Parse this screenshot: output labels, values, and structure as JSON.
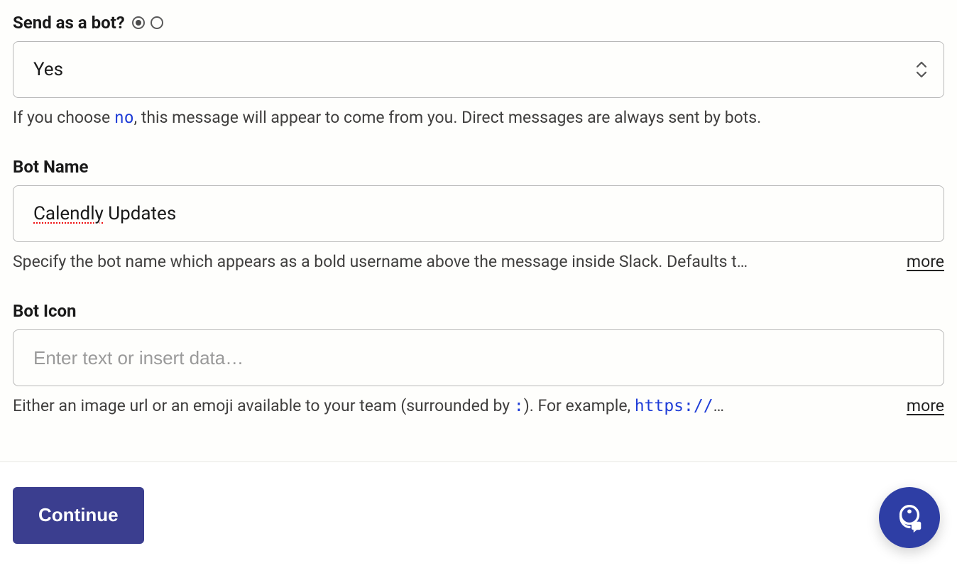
{
  "sendAsBot": {
    "label": "Send as a bot?",
    "radio_selected_index": 0,
    "select_value": "Yes",
    "help_prefix": "If you choose ",
    "help_code": "no",
    "help_suffix": ", this message will appear to come from you. Direct messages are always sent by bots."
  },
  "botName": {
    "label": "Bot Name",
    "value_misspelled": "Calendly",
    "value_rest": " Updates",
    "help_text": "Specify the bot name which appears as a bold username above the message inside Slack. Defaults t…",
    "more_label": "more"
  },
  "botIcon": {
    "label": "Bot Icon",
    "placeholder": "Enter text or insert data…",
    "help_prefix": "Either an image url or an emoji available to your team (surrounded by ",
    "help_code1": ":",
    "help_mid": "). For example, ",
    "help_code2": "https://",
    "help_suffix": "…",
    "more_label": "more"
  },
  "footer": {
    "continue_label": "Continue"
  }
}
